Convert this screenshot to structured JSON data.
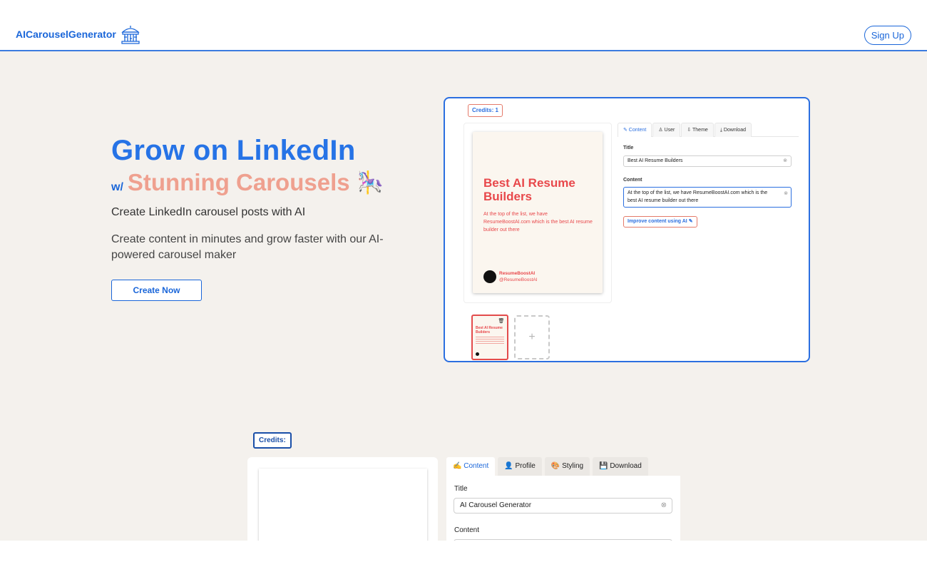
{
  "header": {
    "brand": "AICarouselGenerator",
    "brand_icon": "carousel-icon",
    "signup_label": "Sign Up",
    "accent_color": "#1a66d9"
  },
  "hero": {
    "headline": "Grow on LinkedIn",
    "prefix": "w/",
    "highlight": "Stunning Carousels",
    "emoji": "🎠",
    "tagline": "Create LinkedIn carousel posts with AI",
    "description": "Create content in minutes and grow faster with our AI-powered carousel maker",
    "cta_label": "Create Now"
  },
  "preview": {
    "credits": "Credits: 1",
    "slide": {
      "title": "Best AI Resume Builders",
      "body": "At the top of the list, we have ResumeBoostAI.com which is the best AI resume builder out there",
      "author": "ResumeBoostAI",
      "handle": "@ResumeBoostAI"
    },
    "thumbnail_title": "Best AI Resume Builders",
    "add_label": "+",
    "tabs": [
      "✎ Content",
      "♙ User",
      "⇩ Theme",
      "⤓ Download"
    ],
    "title_label": "Title",
    "title_value": "Best AI Resume Builders",
    "content_label": "Content",
    "content_value": "At the top of the list, we have ResumeBoostAI.com which is the best AI resume builder out there",
    "improve_label": "Improve content using AI ✎"
  },
  "editor": {
    "credits": "Credits:",
    "tabs": [
      "✍️ Content",
      "👤 Profile",
      "🎨 Styling",
      "💾 Download"
    ],
    "title_label": "Title",
    "title_value": "AI Carousel Generator",
    "content_label": "Content"
  }
}
